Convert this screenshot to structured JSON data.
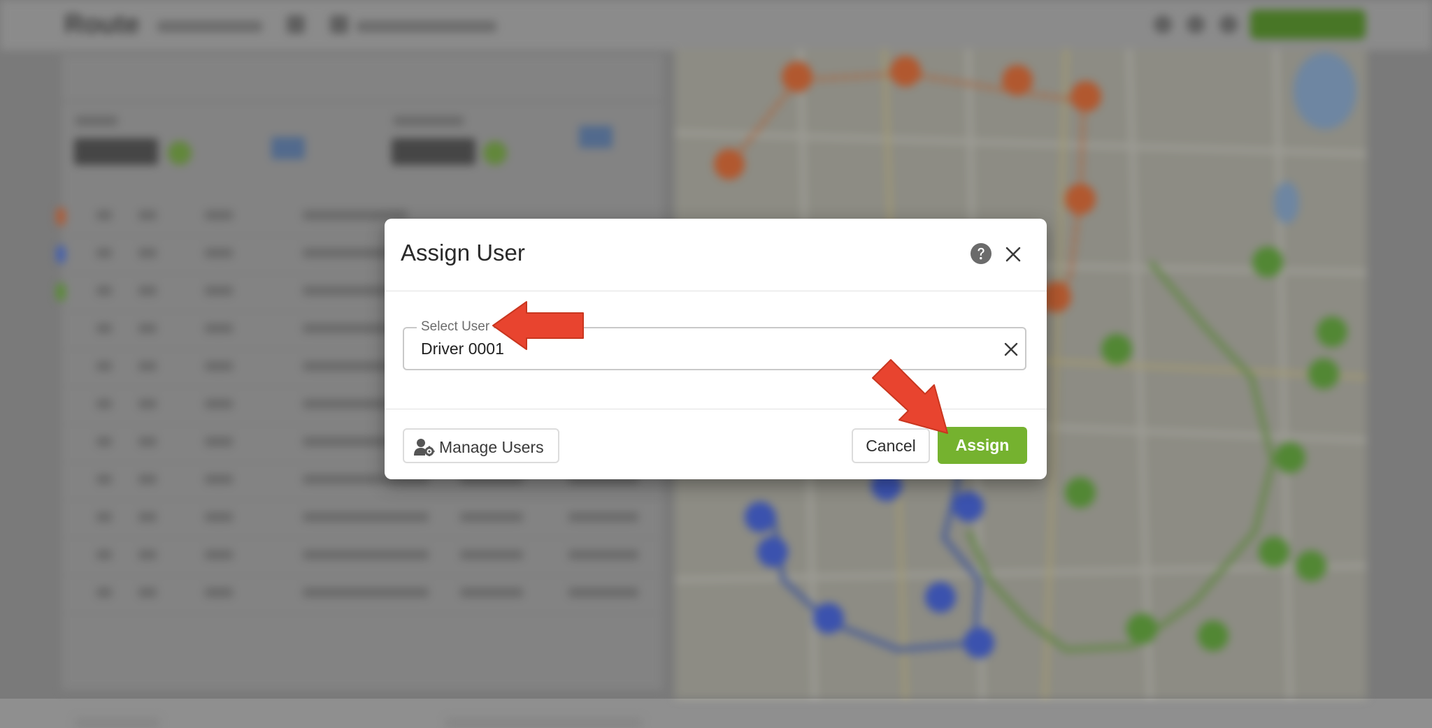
{
  "background_app": {
    "brand": "Route",
    "colors": {
      "accent_green": "#75b22f",
      "route_orange": "#e0622a",
      "route_blue": "#3d5ed6",
      "route_green": "#5aa632"
    }
  },
  "dialog": {
    "title": "Assign User",
    "help_icon": "help-circle-icon",
    "close_icon": "close-icon",
    "field": {
      "label": "Select User",
      "value": "Driver 0001",
      "clear_icon": "clear-icon"
    },
    "buttons": {
      "manage_users": "Manage Users",
      "manage_users_icon": "user-gear-icon",
      "cancel": "Cancel",
      "assign": "Assign"
    },
    "colors": {
      "assign_button": "#75b22f",
      "annotation_arrow": "#e8442f"
    }
  }
}
